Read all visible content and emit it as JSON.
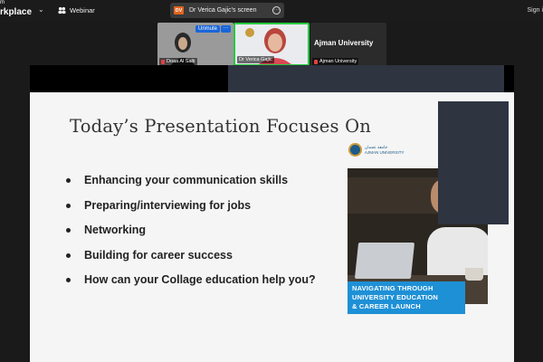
{
  "topbar": {
    "brand_small": "m",
    "brand_big": "rkplace",
    "chevron": "⌄",
    "webinar_label": "Webinar",
    "share_avatar": "DV",
    "share_label": "Dr Verica Gajic's screen",
    "sign_in": "Sign i"
  },
  "participants": {
    "p1_name": "Doaa Al Salti",
    "p1_unmute": "Unmute",
    "p1_more": "···",
    "p2_name": "Dr Verica Gajic",
    "p3_title": "Ajman University",
    "p3_name": "Ajman University"
  },
  "slide": {
    "title": "Today’s Presentation Focuses On",
    "bullets": [
      "Enhancing your communication  skills",
      "Preparing/interviewing for jobs",
      "Networking",
      "Building for career success",
      "How can your Collage education help you?"
    ],
    "logo_arabic": "جامعة عجمان",
    "logo_text": "AJMAN UNIVERSITY",
    "banner_lines": [
      "NAVIGATING THROUGH",
      "UNIVERSITY EDUCATION",
      "& CAREER LAUNCH"
    ]
  },
  "colors": {
    "accent_blue": "#1e90d6",
    "active_speaker": "#27c93f",
    "share_avatar": "#e3631c"
  }
}
